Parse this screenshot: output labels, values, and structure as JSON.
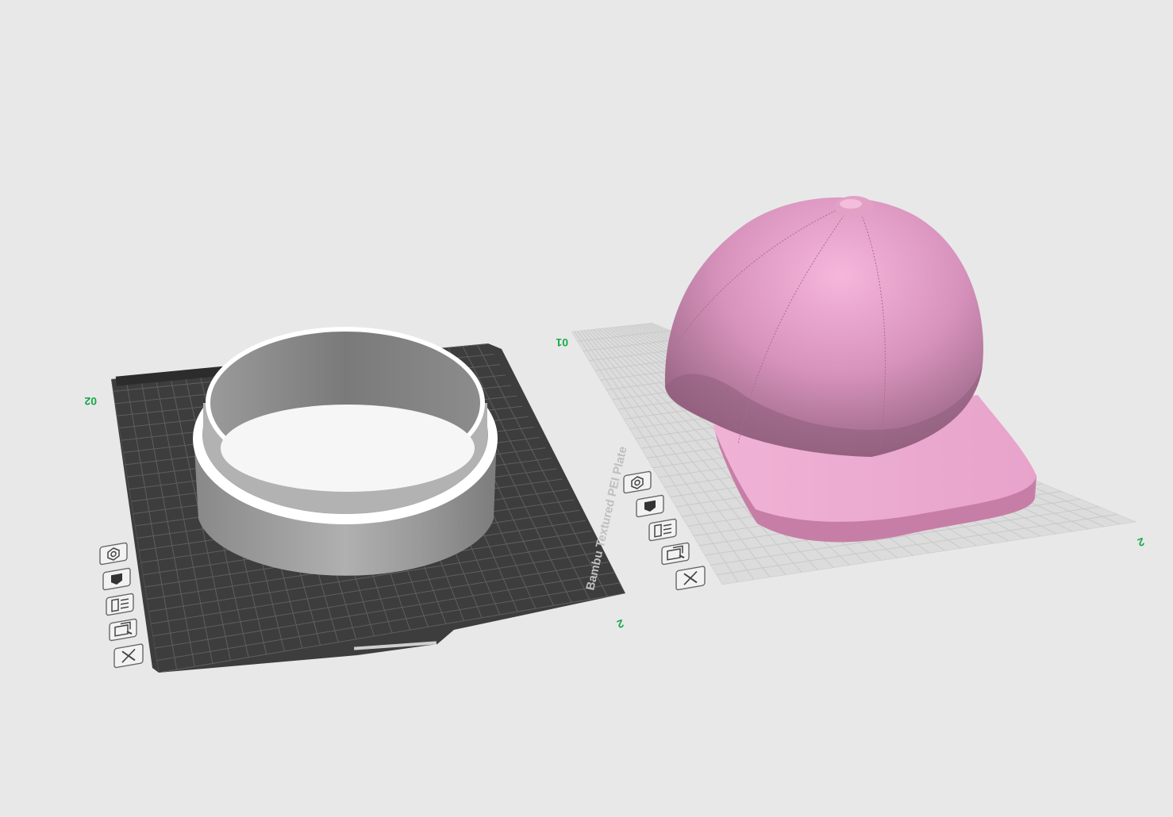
{
  "colors": {
    "background": "#e8e8e8",
    "plate_dark": "#3c3d3c",
    "plate_light": "#dcdcdc",
    "plate_number": "#1aa84a",
    "model_grey": "#9a9a9a",
    "model_pink": "#e8a3cb"
  },
  "plates": [
    {
      "number": "02",
      "brand_label": "Bambu Textured PEI Plate",
      "tools": [
        "settings-icon",
        "filament-icon",
        "arrange-icon",
        "orient-icon",
        "delete-icon"
      ]
    },
    {
      "number": "01",
      "tools": [
        "settings-icon",
        "filament-icon",
        "arrange-icon",
        "orient-icon",
        "delete-icon"
      ]
    }
  ]
}
